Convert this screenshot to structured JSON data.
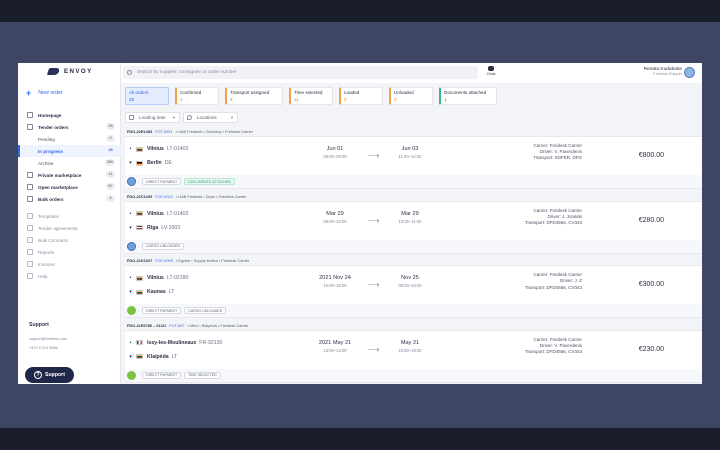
{
  "app": {
    "brand": "ENVOY",
    "new_order": "New order",
    "search_placeholder": "Search by supplier, consignee or order number",
    "chats_label": "Chats",
    "user_name": "Renata Kudabaite",
    "user_role": "Freidesk Shipper"
  },
  "sidebar": {
    "items": [
      {
        "label": "Homepage",
        "count": "",
        "type": "main",
        "active": false
      },
      {
        "label": "Tender orders",
        "count": "28",
        "type": "main",
        "active": false
      },
      {
        "label": "Pending",
        "count": "0",
        "type": "sub",
        "active": false
      },
      {
        "label": "In progress",
        "count": "28",
        "type": "sub",
        "active": true
      },
      {
        "label": "Archive",
        "count": "280",
        "type": "sub",
        "active": false
      },
      {
        "label": "Private marketplace",
        "count": "11",
        "type": "main",
        "active": false
      },
      {
        "label": "Open marketplace",
        "count": "67",
        "type": "main",
        "active": false
      },
      {
        "label": "Bulk orders",
        "count": "4",
        "type": "main",
        "active": false
      },
      {
        "label": "Templates",
        "count": "",
        "type": "dim",
        "active": false
      },
      {
        "label": "Tender agreements",
        "count": "",
        "type": "dim",
        "active": false
      },
      {
        "label": "Bulk Contracts",
        "count": "",
        "type": "dim",
        "active": false
      },
      {
        "label": "Reports",
        "count": "",
        "type": "dim",
        "active": false
      },
      {
        "label": "Invoices",
        "count": "",
        "type": "dim",
        "active": false
      },
      {
        "label": "Help",
        "count": "",
        "type": "dim",
        "active": false
      }
    ],
    "support_title": "Support",
    "support_email": "support@freidesk.com",
    "support_phone": "+370 5 214 0066",
    "support_button": "Support"
  },
  "tabs": [
    {
      "label": "All orders",
      "count": "28",
      "active": true
    },
    {
      "label": "Confirmed",
      "count": "4",
      "active": false
    },
    {
      "label": "Transport assigned",
      "count": "4",
      "active": false
    },
    {
      "label": "Time selected",
      "count": "11",
      "active": false
    },
    {
      "label": "Loaded",
      "count": "0",
      "active": false
    },
    {
      "label": "Unloaded",
      "count": "0",
      "active": false
    },
    {
      "label": "Documents attached",
      "count": "1",
      "active": false
    }
  ],
  "filters": {
    "loading_date": "Loading date",
    "locations": "Locations"
  },
  "orders": [
    {
      "id": "FDO-22E1453",
      "tender": "FOT-0021",
      "route": "• UAB Freidesk  •  Germany  •  Freidesk Carrier",
      "from_city": "Vilnius",
      "from_code": "LT-01402",
      "from_flag": "LT",
      "to_city": "Berlin",
      "to_code": "DE",
      "to_flag": "DE",
      "load_date": "Jun 01",
      "load_hours": "08:00–09:00",
      "unload_date": "Jun 03",
      "unload_hours": "11:00–12:00",
      "carrier": "Carrier: Freidesk Carrier",
      "driver": "Driver: V. Paverdenis",
      "transport": "Transport: SDFER, DFG",
      "price": "€800.00",
      "avatar": "blue",
      "tags": [
        {
          "text": "DIRECT PAYMENT",
          "style": "plain"
        },
        {
          "text": "DOCUMENTS ATTACHED",
          "style": "green"
        }
      ]
    },
    {
      "id": "FDO-22C1269",
      "tender": "FOT-0022",
      "route": "• UAB Freidesk  •  Depo  •  Freidesk Carrier",
      "from_city": "Vilnius",
      "from_code": "LT-01402",
      "from_flag": "LT",
      "to_city": "Riga",
      "to_code": "LV-1003",
      "to_flag": "LV",
      "load_date": "Mar 29",
      "load_hours": "09:00–10:00",
      "unload_date": "Mar 29",
      "unload_hours": "10:00–11:00",
      "carrier": "Carrier: Freidesk Carrier",
      "driver": "Driver: J. Jonaitis",
      "transport": "Transport: DFD4566, CV343",
      "price": "€280.00",
      "avatar": "blue",
      "tags": [
        {
          "text": "CARGO UNLOADED",
          "style": "plain"
        }
      ]
    },
    {
      "id": "FDO-21K1027",
      "tender": "FOT-0009",
      "route": "• Egzine  •  Supply limited  •  Freidesk Carrier",
      "from_city": "Vilnius",
      "from_code": "LT-02180",
      "from_flag": "LT",
      "to_city": "Kaunas",
      "to_code": "LT",
      "to_flag": "LT",
      "load_date": "2021 Nov 24",
      "load_hours": "15:00–16:00",
      "unload_date": "Nov 25",
      "unload_hours": "09:00–10:00",
      "carrier": "Carrier: Freidesk Carrier",
      "driver": "Driver: J. Z",
      "transport": "Transport: DFD4566, CV343",
      "price": "€300.00",
      "avatar": "lime",
      "tags": [
        {
          "text": "DIRECT PAYMENT",
          "style": "plain"
        },
        {
          "text": "CARGO UNLOADED",
          "style": "plain"
        }
      ]
    },
    {
      "id": "FDO-21E9780 – 01/21",
      "tender": "FOT-007",
      "route": "• Minx  •  Klaipėda  •  Freidesk Carrier",
      "from_city": "Issy-les-Moulineaux",
      "from_code": "FR-92130",
      "from_flag": "FR",
      "to_city": "Klaipėda",
      "to_code": "LT",
      "to_flag": "LT",
      "load_date": "2021 May 21",
      "load_hours": "13:00–14:00",
      "unload_date": "May 21",
      "unload_hours": "15:00–16:00",
      "carrier": "Carrier: Freidesk Carrier",
      "driver": "Driver: V. Paverdenis",
      "transport": "Transport: DFD4566, CV343",
      "price": "€230.00",
      "avatar": "lime",
      "tags": [
        {
          "text": "DIRECT PAYMENT",
          "style": "plain"
        },
        {
          "text": "TIME SELECTED",
          "style": "plain"
        }
      ]
    }
  ],
  "colors": {
    "accent": "#2f6be6",
    "orange": "#f0a04b",
    "green": "#40b88a",
    "navy": "#20284a"
  },
  "icons": [
    "search-icon",
    "chat-icon",
    "calendar-icon",
    "pin-icon",
    "plus-icon",
    "help-icon"
  ]
}
